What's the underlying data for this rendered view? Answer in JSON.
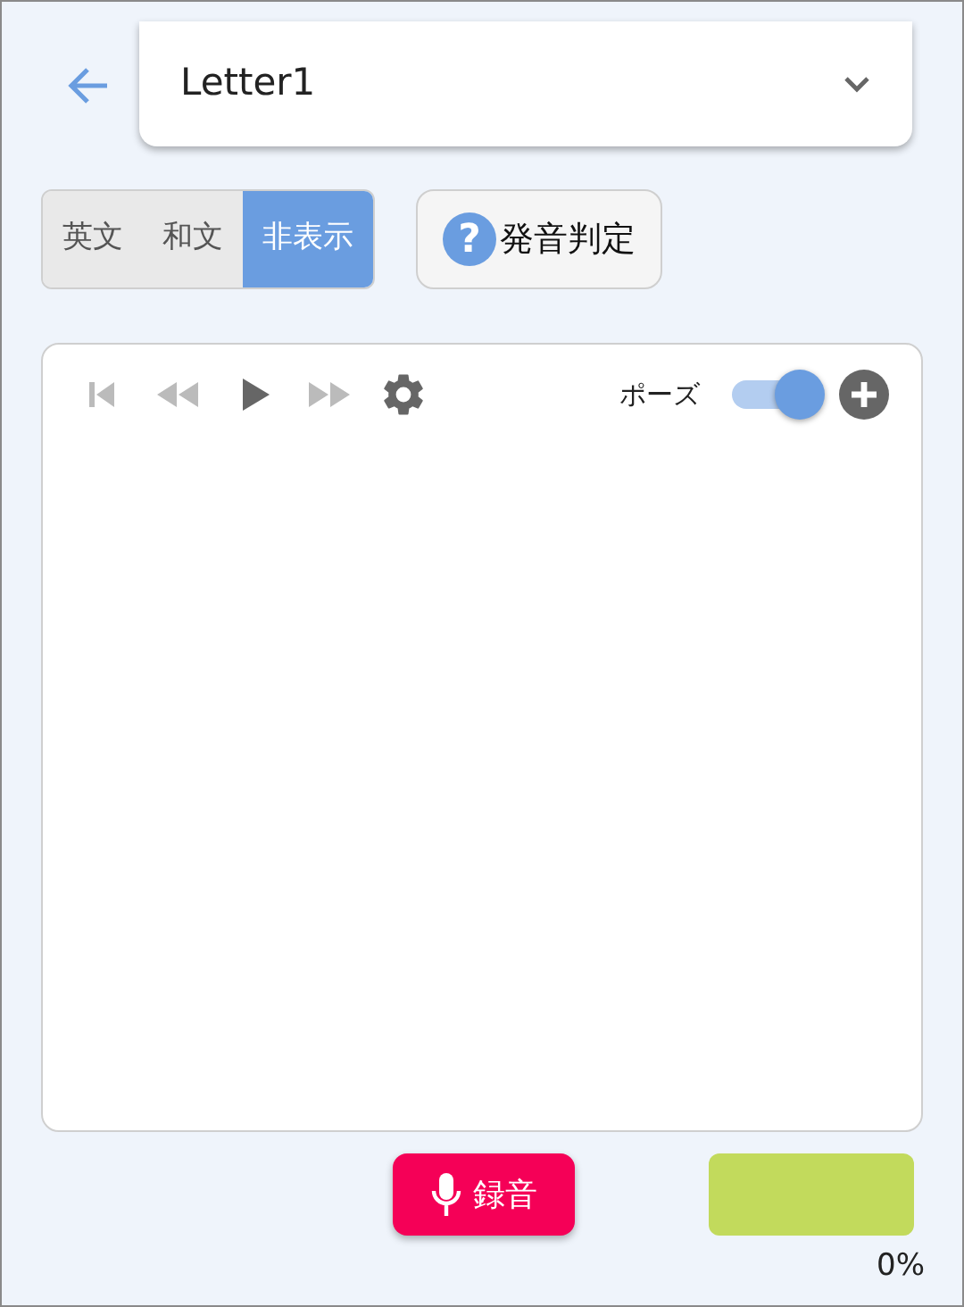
{
  "header": {
    "title": "Letter1"
  },
  "display_modes": [
    {
      "label": "英文",
      "selected": false
    },
    {
      "label": "和文",
      "selected": false
    },
    {
      "label": "非表示",
      "selected": true
    }
  ],
  "judge_button": {
    "icon": "?",
    "label": "発音判定"
  },
  "player": {
    "pause_label": "ポーズ",
    "pause": {
      "on": true
    }
  },
  "record_button": {
    "label": "録音"
  },
  "score": {
    "percent": "0%"
  }
}
